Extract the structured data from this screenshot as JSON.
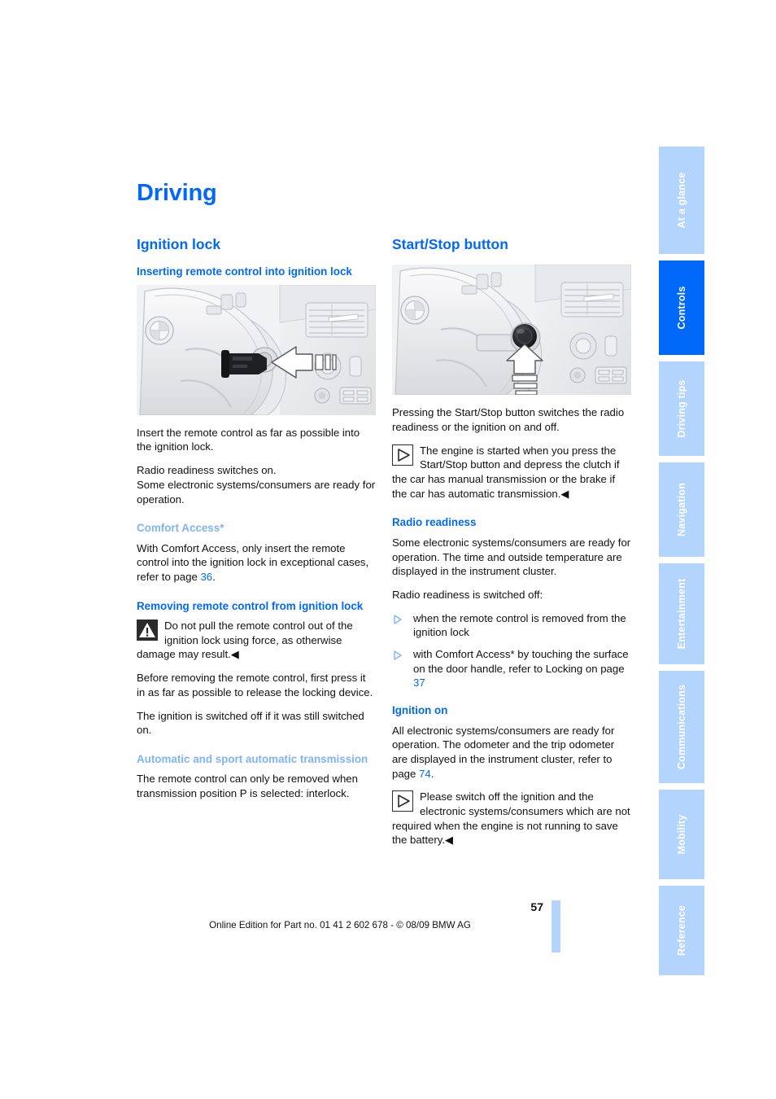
{
  "page": {
    "title": "Driving",
    "number": "57",
    "footer_note": "Online Edition for Part no. 01 41 2 602 678 - © 08/09 BMW AG"
  },
  "colors": {
    "accent": "#0069fa",
    "accent_light": "#7fb4f7",
    "tab_inactive": "#b3d4fd",
    "tab_active": "#0069fa",
    "text": "#111111"
  },
  "sidebar": {
    "tabs": [
      {
        "label": "At a glance",
        "active": false
      },
      {
        "label": "Controls",
        "active": true
      },
      {
        "label": "Driving tips",
        "active": false
      },
      {
        "label": "Navigation",
        "active": false
      },
      {
        "label": "Entertainment",
        "active": false
      },
      {
        "label": "Communications",
        "active": false
      },
      {
        "label": "Mobility",
        "active": false
      },
      {
        "label": "Reference",
        "active": false
      }
    ]
  },
  "left_column": {
    "section_title": "Ignition lock",
    "sub1_title": "Inserting remote control into ignition lock",
    "illustration_caption": "ignition-lock-remote-control-insertion",
    "p1": "Insert the remote control as far as possible into the ignition lock.",
    "p2_line1": "Radio readiness switches on.",
    "p2_line2": "Some electronic systems/consumers are ready for operation.",
    "sub2_title": "Comfort Access*",
    "p3_pre": "With Comfort Access, only insert the remote control into the ignition lock in exceptional cases, refer to page ",
    "p3_ref": "36",
    "p3_post": ".",
    "sub3_title": "Removing remote control from ignition lock",
    "warn_text": "Do not pull the remote control out of the ignition lock using force, as otherwise damage may result.◀",
    "p4": "Before removing the remote control, first press it in as far as possible to release the locking device.",
    "p5": "The ignition is switched off if it was still switched on.",
    "sub4_title": "Automatic and sport automatic transmission",
    "p6": "The remote control can only be removed when transmission position P is selected: interlock."
  },
  "right_column": {
    "section_title": "Start/Stop button",
    "illustration_caption": "start-stop-button-steering-column",
    "p1": "Pressing the Start/Stop button switches the radio readiness or the ignition on and off.",
    "info1_text": "The engine is started when you press the Start/Stop button and depress the clutch if the car has manual transmission or the brake if the car has automatic transmission.◀",
    "sub1_title": "Radio readiness",
    "p2": "Some electronic systems/consumers are ready for operation. The time and outside temperature are displayed in the instrument cluster.",
    "p3": "Radio readiness is switched off:",
    "bullets": [
      {
        "text": "when the remote control is removed from the ignition lock"
      },
      {
        "pre": "with Comfort Access* by touching the surface on the door handle, refer to Locking on page ",
        "ref": "37",
        "post": ""
      }
    ],
    "sub2_title": "Ignition on",
    "p4_pre": "All electronic systems/consumers are ready for operation. The odometer and the trip odometer are displayed in the instrument cluster, refer to page ",
    "p4_ref": "74",
    "p4_post": ".",
    "info2_text": "Please switch off the ignition and the electronic systems/consumers which are not required when the engine is not running to save the battery.◀"
  },
  "icons": {
    "warning": "warning-triangle-icon",
    "info": "info-play-triangle-icon",
    "bullet": "bullet-triangle-icon"
  }
}
